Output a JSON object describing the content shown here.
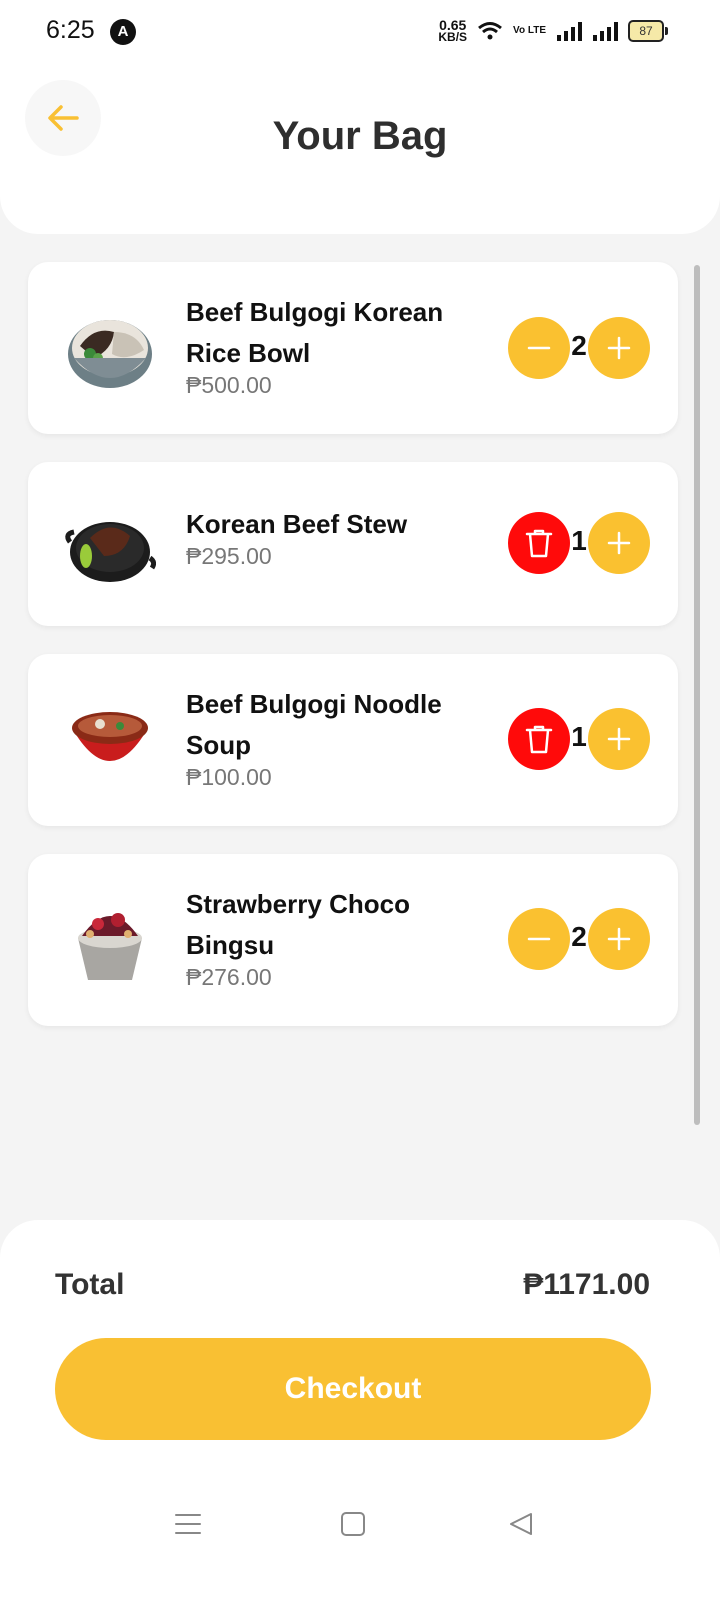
{
  "status_bar": {
    "time": "6:25",
    "app_icon_letter": "A",
    "net_speed_value": "0.65",
    "net_speed_unit": "KB/S",
    "volte": "Vo LTE",
    "battery": "87"
  },
  "header": {
    "title": "Your Bag",
    "back_icon": "arrow-left-icon"
  },
  "cart": {
    "items": [
      {
        "name": "Beef Bulgogi Korean Rice Bowl",
        "price": "₱500.00",
        "quantity": "2",
        "decrease_icon": "minus-icon"
      },
      {
        "name": "Korean Beef Stew",
        "price": "₱295.00",
        "quantity": "1",
        "decrease_icon": "trash-icon"
      },
      {
        "name": "Beef Bulgogi Noodle Soup",
        "price": "₱100.00",
        "quantity": "1",
        "decrease_icon": "trash-icon"
      },
      {
        "name": "Strawberry Choco Bingsu",
        "price": "₱276.00",
        "quantity": "2",
        "decrease_icon": "minus-icon"
      }
    ]
  },
  "footer": {
    "total_label": "Total",
    "total_value": "₱1171.00",
    "checkout_label": "Checkout"
  },
  "colors": {
    "accent": "#f9c033",
    "delete": "#ff0a0a",
    "background": "#f4f4f4"
  },
  "nav_bar": {
    "icons": [
      "menu-icon",
      "home-square-icon",
      "back-triangle-icon"
    ]
  }
}
